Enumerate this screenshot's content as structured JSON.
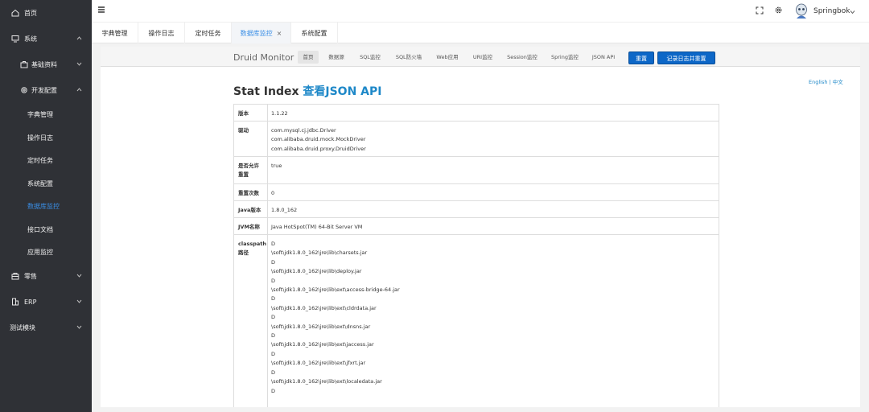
{
  "sidebar": {
    "items": [
      {
        "label": "首页",
        "icon": "home-icon"
      },
      {
        "label": "系统",
        "icon": "monitor-icon"
      },
      {
        "label": "基础资料",
        "icon": "briefcase-icon"
      },
      {
        "label": "开发配置",
        "icon": "gear-icon"
      },
      {
        "label": "字典管理"
      },
      {
        "label": "操作日志"
      },
      {
        "label": "定时任务"
      },
      {
        "label": "系统配置"
      },
      {
        "label": "数据库监控"
      },
      {
        "label": "接口文档"
      },
      {
        "label": "应用监控"
      },
      {
        "label": "零售",
        "icon": "shop-icon"
      },
      {
        "label": "ERP",
        "icon": "building-icon"
      },
      {
        "label": "测试模块"
      }
    ],
    "active_color": "#3a8ee6",
    "bg_color": "#2f3136"
  },
  "header": {
    "username": "Springbok"
  },
  "tabs": [
    {
      "label": "字典管理"
    },
    {
      "label": "操作日志"
    },
    {
      "label": "定时任务"
    },
    {
      "label": "数据库监控",
      "close": "×"
    },
    {
      "label": "系统配置"
    }
  ],
  "druid": {
    "brand": "Druid Monitor",
    "nav": [
      "首页",
      "数据源",
      "SQL监控",
      "SQL防火墙",
      "Web应用",
      "URI监控",
      "Session监控",
      "Spring监控",
      "JSON API"
    ],
    "reset_button": "重置",
    "log_reset_button": "记录日志并重置",
    "lang": "English | 中文",
    "title": "Stat Index",
    "title_link": "查看JSON API",
    "rows": {
      "version": {
        "key": "版本",
        "values": [
          "1.1.22"
        ]
      },
      "driver": {
        "key": "驱动",
        "values": [
          "com.mysql.cj.jdbc.Driver",
          "com.alibaba.druid.mock.MockDriver",
          "com.alibaba.druid.proxy.DruidDriver"
        ]
      },
      "reset_allowed": {
        "key": "是否允许重置",
        "values": [
          "true"
        ]
      },
      "reset_count": {
        "key": "重置次数",
        "values": [
          "0"
        ]
      },
      "java_version": {
        "key": "Java版本",
        "values": [
          "1.8.0_162"
        ]
      },
      "jvm_name": {
        "key": "JVM名称",
        "values": [
          "Java HotSpot(TM) 64-Bit Server VM"
        ]
      },
      "classpath": {
        "key": "classpath路径",
        "values": [
          "D",
          "\\soft\\jdk1.8.0_162\\jre\\lib\\charsets.jar",
          "D",
          "\\soft\\jdk1.8.0_162\\jre\\lib\\deploy.jar",
          "D",
          "\\soft\\jdk1.8.0_162\\jre\\lib\\ext\\access-bridge-64.jar",
          "D",
          "\\soft\\jdk1.8.0_162\\jre\\lib\\ext\\cldrdata.jar",
          "D",
          "\\soft\\jdk1.8.0_162\\jre\\lib\\ext\\dnsns.jar",
          "D",
          "\\soft\\jdk1.8.0_162\\jre\\lib\\ext\\jaccess.jar",
          "D",
          "\\soft\\jdk1.8.0_162\\jre\\lib\\ext\\jfxrt.jar",
          "D",
          "\\soft\\jdk1.8.0_162\\jre\\lib\\ext\\localedata.jar",
          "D"
        ]
      }
    }
  }
}
